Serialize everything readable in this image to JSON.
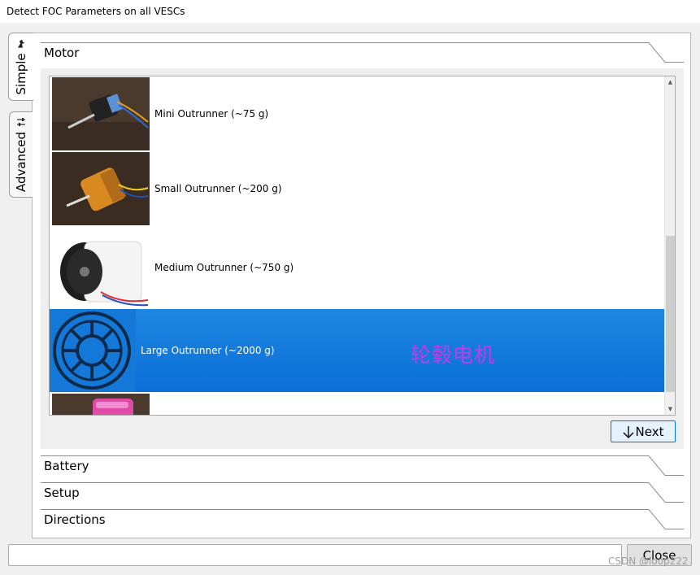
{
  "window": {
    "title": "Detect FOC Parameters on all VESCs"
  },
  "tabs": [
    {
      "label": "Simple",
      "icon": "person-icon",
      "active": true
    },
    {
      "label": "Advanced",
      "icon": "sliders-icon",
      "active": false
    }
  ],
  "sections": {
    "motor": "Motor",
    "battery": "Battery",
    "setup": "Setup",
    "directions": "Directions"
  },
  "motor_list": [
    {
      "label": "Mini Outrunner (~75 g)",
      "selected": false
    },
    {
      "label": "Small Outrunner (~200 g)",
      "selected": false
    },
    {
      "label": "Medium Outrunner (~750 g)",
      "selected": false
    },
    {
      "label": "Large Outrunner (~2000 g)",
      "selected": true
    },
    {
      "label": "",
      "selected": false
    }
  ],
  "annotation": "轮毂电机",
  "buttons": {
    "next": "Next",
    "close": "Close"
  },
  "status_field": {
    "value": ""
  },
  "watermark": "CSDN @loop222",
  "colors": {
    "selection": "#0a6fd8",
    "annotation": "#c43ae6",
    "accent_border": "#0078d7"
  }
}
